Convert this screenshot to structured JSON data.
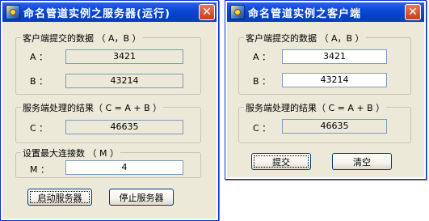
{
  "server": {
    "title": "命名管道实例之服务器(运行)",
    "input_group": {
      "label": "客户端提交的数据 （ A，B ）",
      "a_label": "A ：",
      "a_value": "3421",
      "b_label": "B ：",
      "b_value": "43214"
    },
    "result_group": {
      "label": "服务端处理的结果（ C = A + B ）",
      "c_label": "C ：",
      "c_value": "46635"
    },
    "max_group": {
      "label": "设置最大连接数 （ M ）",
      "m_label": "M ：",
      "m_value": "4"
    },
    "start_button": "启动服务器",
    "stop_button": "停止服务器"
  },
  "client": {
    "title": "命名管道实例之客户端",
    "input_group": {
      "label": "客户端提交的数据 （ A，B ）",
      "a_label": "A ：",
      "a_value": "3421",
      "b_label": "B ：",
      "b_value": "43214"
    },
    "result_group": {
      "label": "服务端处理的结果（ C = A + B ）",
      "c_label": "C ：",
      "c_value": "46635"
    },
    "submit_button": "提交",
    "clear_button": "清空"
  },
  "icons": {
    "app": "pipe-app-icon",
    "close": "close-icon"
  },
  "colors": {
    "titlebar": "#0a4ad6",
    "window_bg": "#ece9d8",
    "close_button": "#d0522a"
  }
}
